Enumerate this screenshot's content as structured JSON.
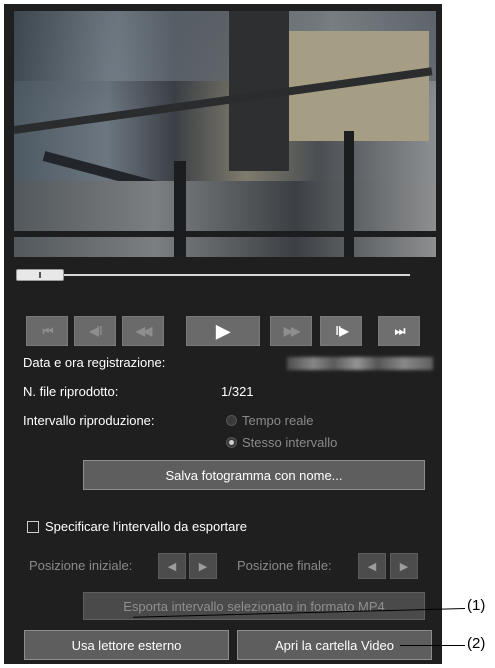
{
  "controls": {
    "first_icon": "⏮",
    "prev_frame_icon": "◀‖",
    "rewind_icon": "◀◀",
    "play_icon": "▶",
    "forward_icon": "▶▶",
    "next_frame_icon": "‖▶",
    "last_icon": "⏭"
  },
  "info": {
    "recorded_label": "Data e ora registrazione:",
    "file_label": "N. file riprodotto:",
    "file_value": "1/321",
    "interval_label": "Intervallo riproduzione:",
    "option_realtime": "Tempo reale",
    "option_same": "Stesso intervallo"
  },
  "save_button": "Salva fotogramma con nome...",
  "export": {
    "checkbox_label": "Specificare l'intervallo da esportare",
    "start_label": "Posizione iniziale:",
    "end_label": "Posizione finale:",
    "export_button": "Esporta intervallo selezionato in formato MP4"
  },
  "external_player_button": "Usa lettore esterno",
  "open_folder_button": "Apri la cartella Video",
  "callouts": [
    "(1)",
    "(2)"
  ],
  "colors": {
    "panel": "#1f1f1f",
    "button": "#5e5e5e"
  }
}
